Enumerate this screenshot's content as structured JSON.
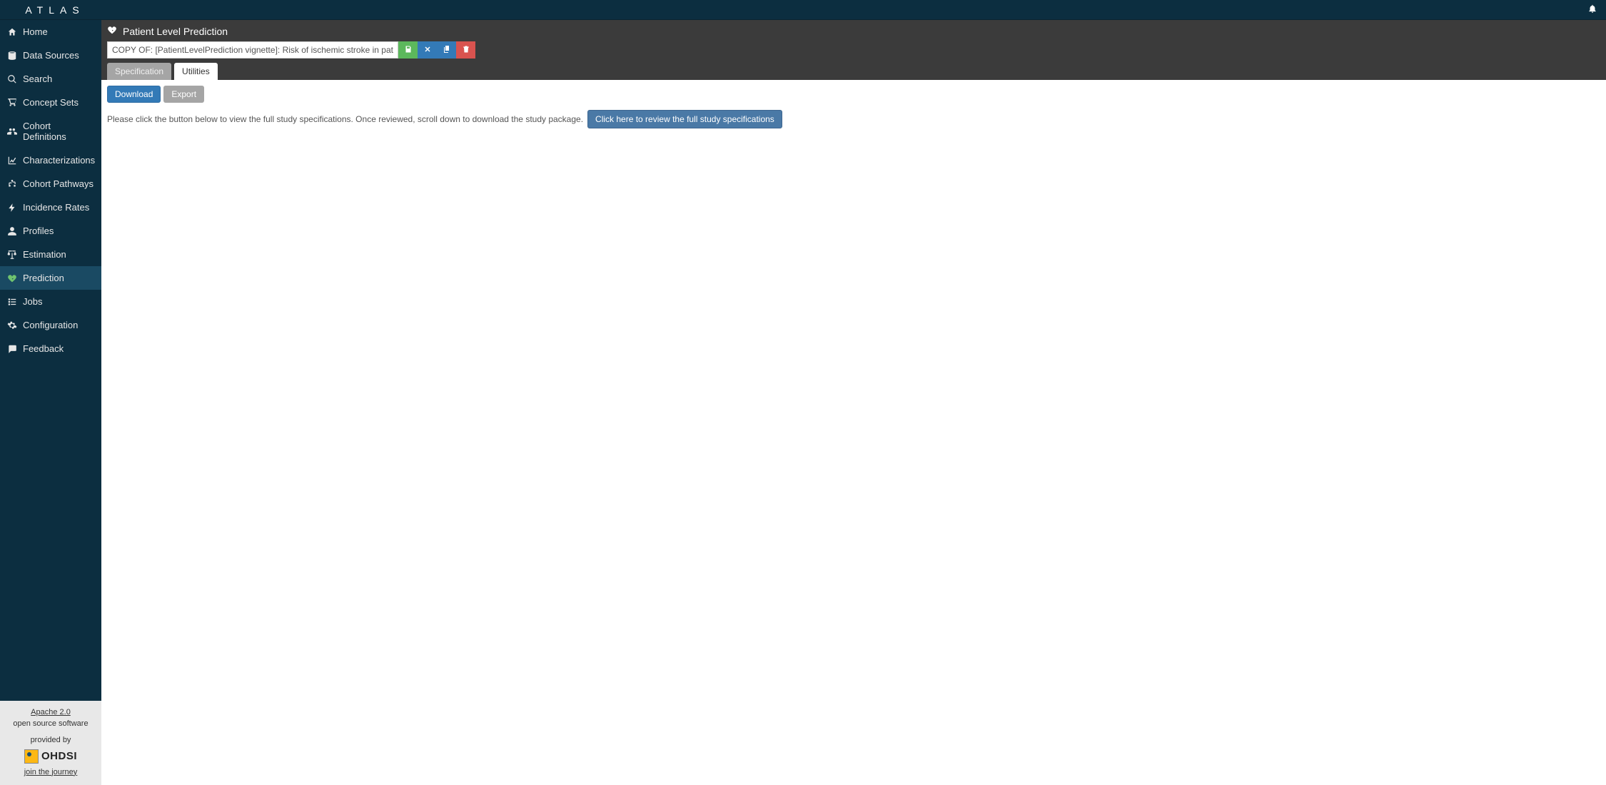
{
  "brand": "ATLAS",
  "sidebar": {
    "items": [
      {
        "label": "Home",
        "active": false
      },
      {
        "label": "Data Sources",
        "active": false
      },
      {
        "label": "Search",
        "active": false
      },
      {
        "label": "Concept Sets",
        "active": false
      },
      {
        "label": "Cohort Definitions",
        "active": false
      },
      {
        "label": "Characterizations",
        "active": false
      },
      {
        "label": "Cohort Pathways",
        "active": false
      },
      {
        "label": "Incidence Rates",
        "active": false
      },
      {
        "label": "Profiles",
        "active": false
      },
      {
        "label": "Estimation",
        "active": false
      },
      {
        "label": "Prediction",
        "active": true
      },
      {
        "label": "Jobs",
        "active": false
      },
      {
        "label": "Configuration",
        "active": false
      },
      {
        "label": "Feedback",
        "active": false
      }
    ],
    "footer": {
      "license_link": "Apache 2.0",
      "license_sub": "open source software",
      "provided_by": "provided by",
      "logo_text": "OHDSI",
      "join_link": "join the journey"
    }
  },
  "page": {
    "title": "Patient Level Prediction",
    "name_value": "COPY OF: [PatientLevelPrediction vignette]: Risk of ischemic stroke in patients with Atrial fibri",
    "tabs": {
      "specification": "Specification",
      "utilities": "Utilities"
    },
    "subtabs": {
      "download": "Download",
      "export": "Export"
    },
    "instruction_text": "Please click the button below to view the full study specifications. Once reviewed, scroll down to download the study package.",
    "review_button": "Click here to review the full study specifications"
  }
}
